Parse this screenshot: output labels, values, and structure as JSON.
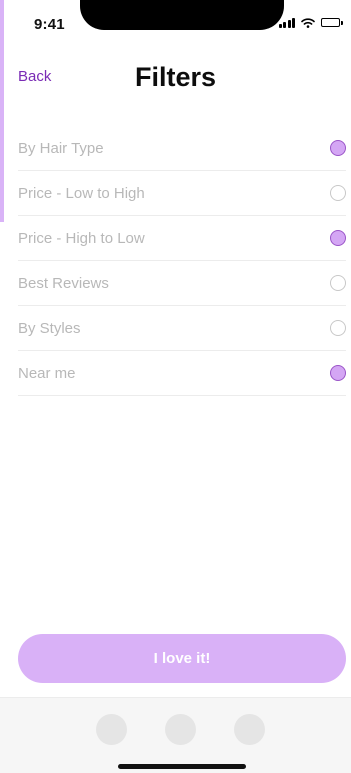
{
  "status_bar": {
    "time": "9:41",
    "icons": [
      "cellular-signal-icon",
      "wifi-icon",
      "battery-icon"
    ]
  },
  "header": {
    "back_label": "Back",
    "title": "Filters"
  },
  "filters": [
    {
      "label": "By Hair Type",
      "selected": true
    },
    {
      "label": "Price - Low to High",
      "selected": false
    },
    {
      "label": "Price - High to Low",
      "selected": true
    },
    {
      "label": "Best Reviews",
      "selected": false
    },
    {
      "label": "By Styles",
      "selected": false
    },
    {
      "label": "Near me",
      "selected": true
    }
  ],
  "cta": {
    "label": "I love it!"
  },
  "tab_bar": {
    "items": [
      "tab-item",
      "tab-item",
      "tab-item"
    ]
  },
  "colors": {
    "accent": "#d9b1f7",
    "back_link": "#7a2bb5",
    "radio_selected": "#d4a6f4",
    "label_text": "#b8b8b8"
  }
}
